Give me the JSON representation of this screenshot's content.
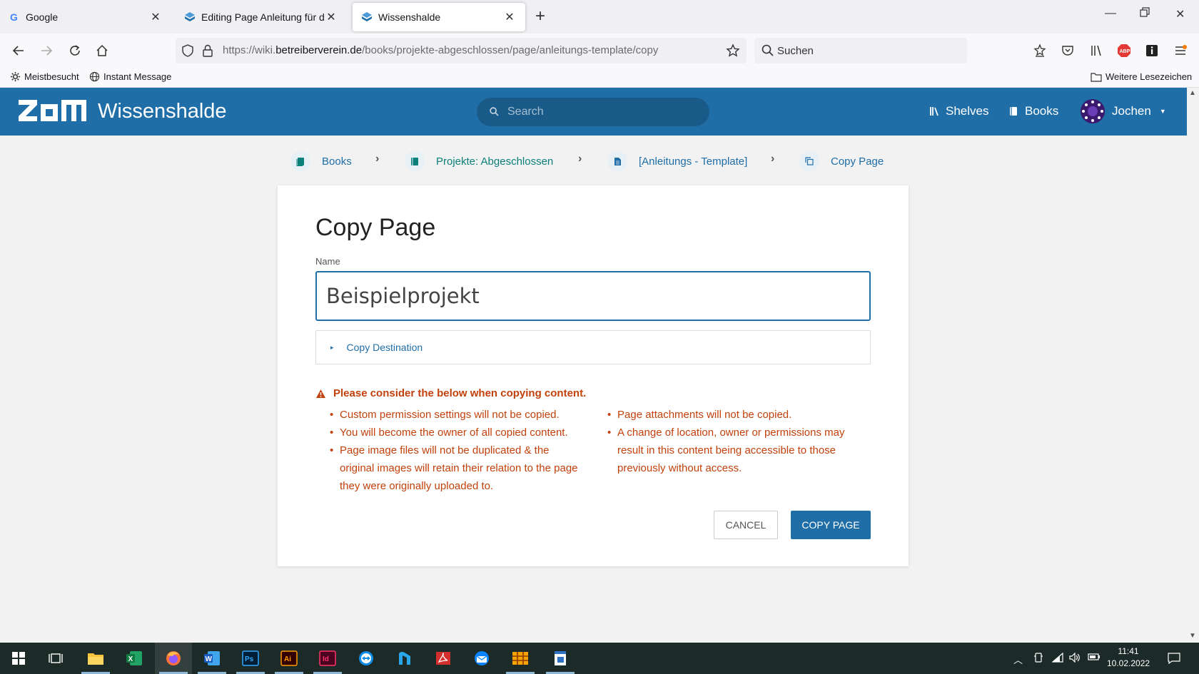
{
  "browser": {
    "tabs": [
      {
        "label": "Google",
        "active": false
      },
      {
        "label": "Editing Page Anleitung für das I",
        "active": false
      },
      {
        "label": "Wissenshalde",
        "active": true
      }
    ],
    "url_prefix": "https://wiki.",
    "url_domain": "betreiberverein.de",
    "url_path": "/books/projekte-abgeschlossen/page/anleitungs-template/copy",
    "search_placeholder": "Suchen",
    "bookmarks": [
      {
        "label": "Meistbesucht",
        "icon": "gear-icon"
      },
      {
        "label": "Instant Message",
        "icon": "globe-icon"
      }
    ],
    "bookmarks_other": "Weitere Lesezeichen"
  },
  "app": {
    "site_name": "Wissenshalde",
    "search_placeholder": "Search",
    "nav": {
      "shelves": "Shelves",
      "books": "Books"
    },
    "user_name": "Jochen",
    "brand_color": "#206ea7"
  },
  "breadcrumbs": [
    {
      "label": "Books",
      "icon": "books-icon"
    },
    {
      "label": "Projekte: Abgeschlossen",
      "icon": "book-icon"
    },
    {
      "label": "[Anleitungs - Template]",
      "icon": "page-icon"
    },
    {
      "label": "Copy Page",
      "icon": "copy-icon"
    }
  ],
  "form": {
    "title": "Copy Page",
    "name_label": "Name",
    "name_value": "Beispielprojekt",
    "destination_label": "Copy Destination",
    "warning_title": "Please consider the below when copying content.",
    "warnings_left": [
      "Custom permission settings will not be copied.",
      "You will become the owner of all copied content.",
      "Page image files will not be duplicated & the original images will retain their relation to the page they were originally uploaded to."
    ],
    "warnings_right": [
      "Page attachments will not be copied.",
      "A change of location, owner or permissions may result in this content being accessible to those previously without access."
    ],
    "cancel_label": "CANCEL",
    "submit_label": "COPY PAGE",
    "warning_color": "#c2410c"
  },
  "taskbar": {
    "time": "11:41",
    "date": "10.02.2022"
  }
}
